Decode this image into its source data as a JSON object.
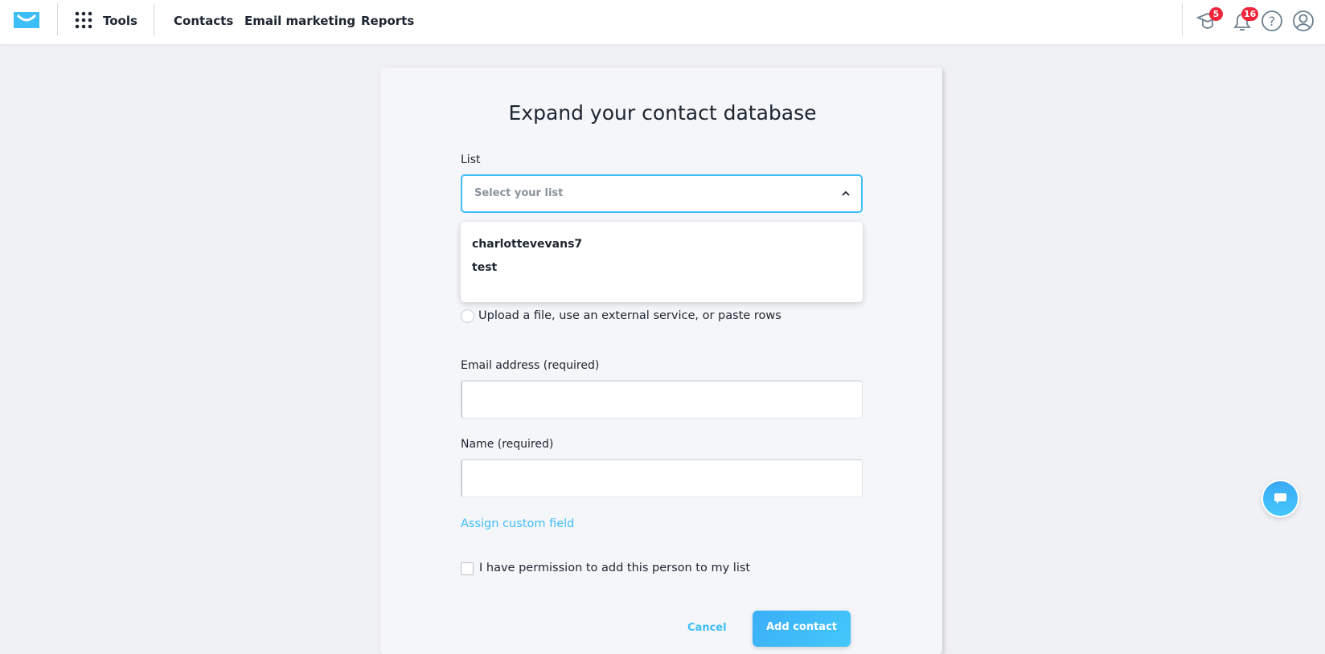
{
  "nav": {
    "tools": "Tools",
    "items": [
      "Contacts",
      "Email marketing",
      "Reports"
    ],
    "badges": {
      "academy": "5",
      "notifications": "16"
    },
    "brand_color": "#3ebef7"
  },
  "form": {
    "title": "Expand your contact database",
    "list_label": "List",
    "list_placeholder": "Select your list",
    "list_options": [
      "charlottevevans7",
      "test"
    ],
    "upload_option": "Upload a file, use an external service, or paste rows",
    "email_label": "Email address (required)",
    "email_value": "",
    "name_label": "Name (required)",
    "name_value": "",
    "assign_link": "Assign custom field",
    "permission_label": "I have permission to add this person to my list",
    "permission_checked": false,
    "cancel": "Cancel",
    "submit": "Add contact"
  }
}
